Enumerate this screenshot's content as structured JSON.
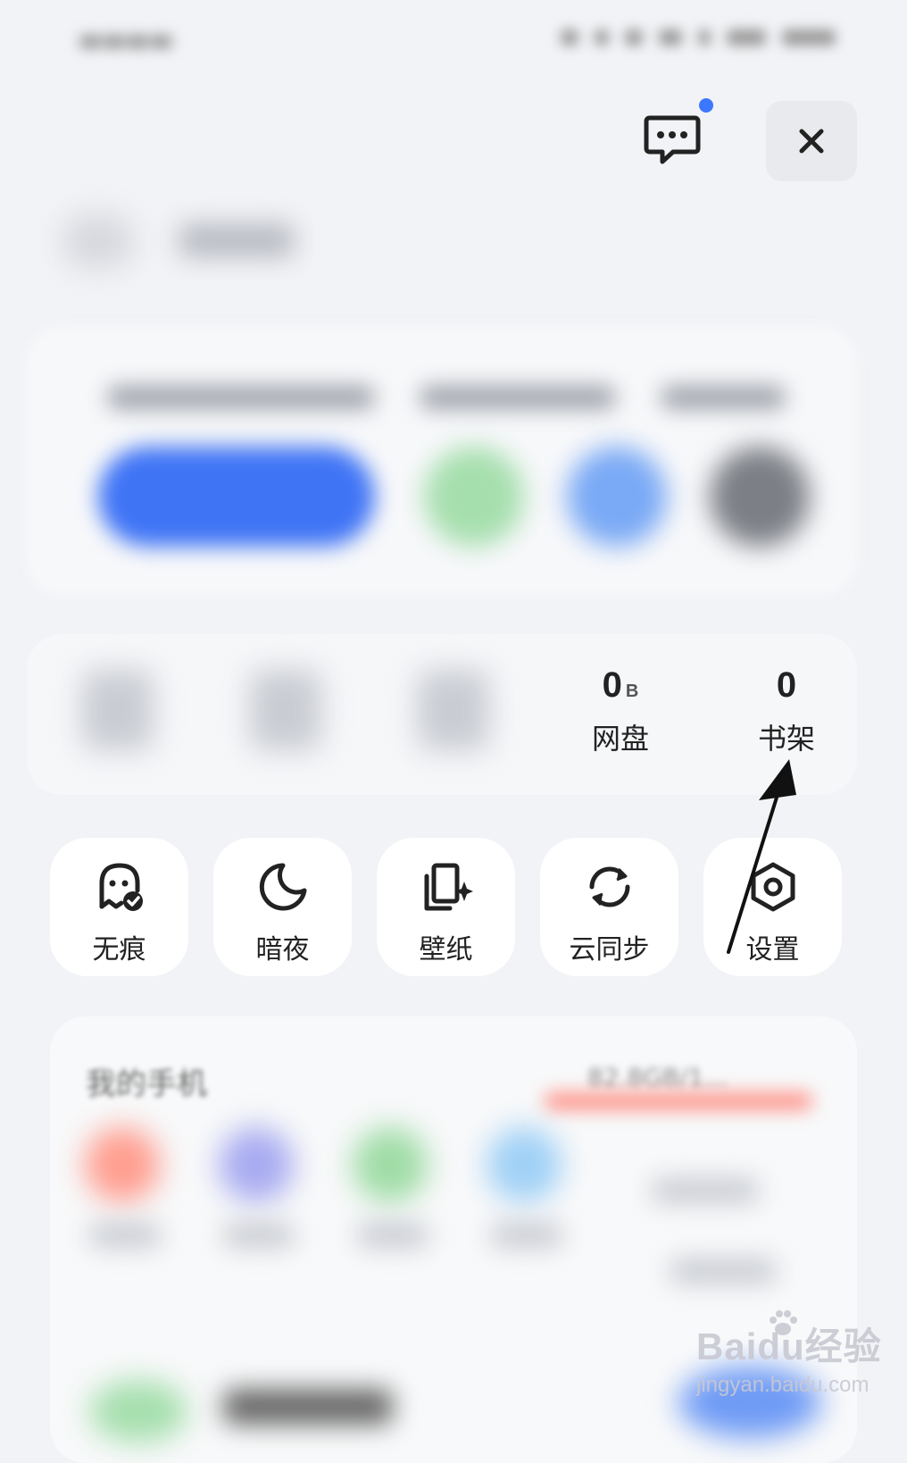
{
  "stats": {
    "netdisk": {
      "value": "0",
      "unit": "B",
      "label": "网盘"
    },
    "bookshelf": {
      "value": "0",
      "label": "书架"
    }
  },
  "quick_actions": [
    {
      "label": "无痕",
      "icon": "ghost-check-icon"
    },
    {
      "label": "暗夜",
      "icon": "moon-icon"
    },
    {
      "label": "壁纸",
      "icon": "wallpaper-icon"
    },
    {
      "label": "云同步",
      "icon": "sync-icon"
    },
    {
      "label": "设置",
      "icon": "settings-hex-icon"
    }
  ],
  "phone_card": {
    "title": "我的手机",
    "storage": "82.8GB/1..."
  },
  "header": {
    "message_icon": "message-icon",
    "close_icon": "close-icon",
    "notification_color": "#3c78ff"
  },
  "watermark": {
    "brand": "Baidu经验",
    "url": "jingyan.baidu.com"
  },
  "colors": {
    "background": "#f2f3f6",
    "card": "#ffffff",
    "accent": "#3f74f5"
  }
}
